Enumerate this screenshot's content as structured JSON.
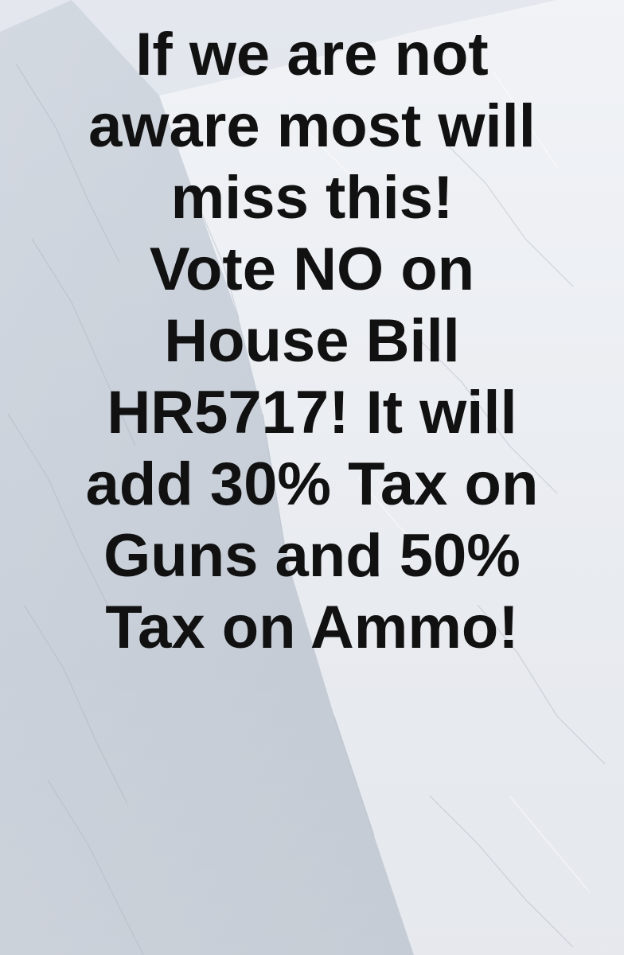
{
  "background": {
    "scene": "snowy-mountain-slope",
    "colors": {
      "sky": "#e4e8ee",
      "snow_light": "#f2f4f7",
      "snow_shadow": "#b9c1cc",
      "text": "#111111"
    }
  },
  "message": {
    "lines": [
      "If we are not",
      "aware most will",
      "miss this!",
      "Vote NO on",
      "House Bill",
      "HR5717! It will",
      "add 30% Tax on",
      "Guns and 50%",
      "Tax on Ammo!"
    ]
  }
}
